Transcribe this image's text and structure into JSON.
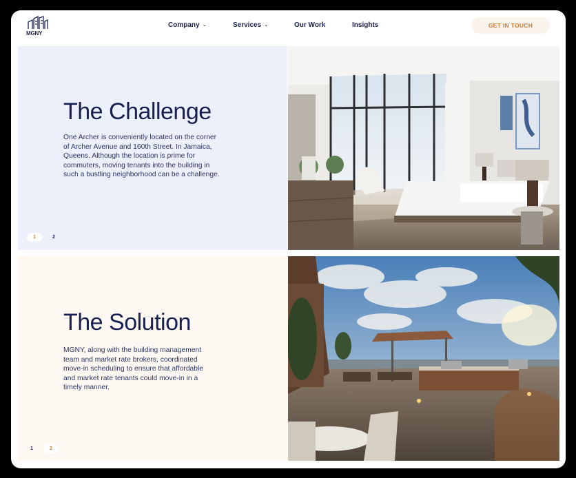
{
  "header": {
    "logo_text": "MGNY",
    "nav": [
      {
        "label": "Company",
        "dropdown": true
      },
      {
        "label": "Services",
        "dropdown": true
      },
      {
        "label": "Our Work",
        "dropdown": false
      },
      {
        "label": "Insights",
        "dropdown": false
      }
    ],
    "cta_label": "GET IN TOUCH"
  },
  "sections": [
    {
      "title": "The Challenge",
      "body": "One Archer is conveniently located on the corner of Archer Avenue and 160th Street. In Jamaica, Queens. Although the location is prime for commuters, moving tenants into the building in such a bustling neighborhood can be a challenge.",
      "pager": [
        "1",
        "2"
      ],
      "active_page": 0
    },
    {
      "title": "The Solution",
      "body": "MGNY, along with the building management team and market rate brokers, coordinated move-in scheduling to ensure that affordable and market rate tenants could move-in in a timely manner.",
      "pager": [
        "1",
        "2"
      ],
      "active_page": 1
    }
  ],
  "colors": {
    "navy": "#17204f",
    "accent": "#c77b34",
    "challenge_bg": "#ecf0fb",
    "solution_bg": "#fdf8f2",
    "cta_bg": "#fbf4ec"
  }
}
